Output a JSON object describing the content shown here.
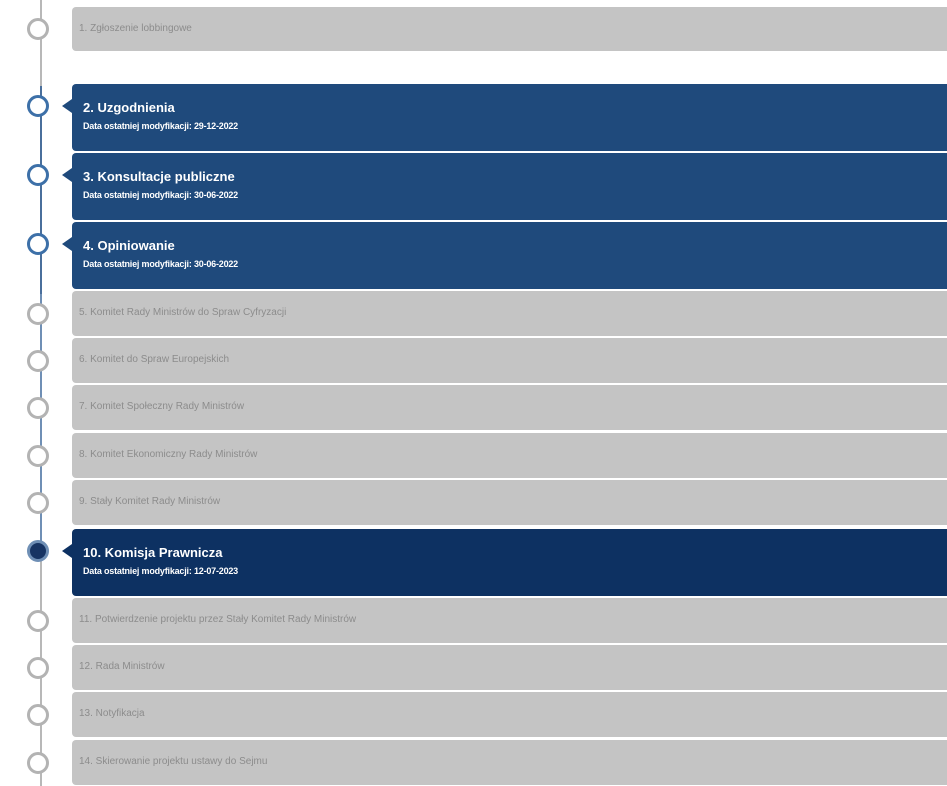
{
  "stages": [
    {
      "label": "1. Zgłoszenie lobbingowe",
      "status": "inactive"
    },
    {
      "label": "2. Uzgodnienia",
      "status": "done",
      "date_prefix": "Data ostatniej modyfikacji:",
      "date": "29-12-2022"
    },
    {
      "label": "3. Konsultacje publiczne",
      "status": "done",
      "date_prefix": "Data ostatniej modyfikacji:",
      "date": "30-06-2022"
    },
    {
      "label": "4. Opiniowanie",
      "status": "done",
      "date_prefix": "Data ostatniej modyfikacji:",
      "date": "30-06-2022"
    },
    {
      "label": "5. Komitet Rady Ministrów do Spraw Cyfryzacji",
      "status": "inactive"
    },
    {
      "label": "6. Komitet do Spraw Europejskich",
      "status": "inactive"
    },
    {
      "label": "7. Komitet Społeczny Rady Ministrów",
      "status": "inactive"
    },
    {
      "label": "8. Komitet Ekonomiczny Rady Ministrów",
      "status": "inactive"
    },
    {
      "label": "9. Stały Komitet Rady Ministrów",
      "status": "inactive"
    },
    {
      "label": "10. Komisja Prawnicza",
      "status": "current",
      "date_prefix": "Data ostatniej modyfikacji:",
      "date": "12-07-2023"
    },
    {
      "label": "11. Potwierdzenie projektu przez Stały Komitet Rady Ministrów",
      "status": "inactive"
    },
    {
      "label": "12. Rada Ministrów",
      "status": "inactive"
    },
    {
      "label": "13. Notyfikacja",
      "status": "inactive"
    },
    {
      "label": "14. Skierowanie projektu ustawy do Sejmu",
      "status": "inactive"
    }
  ],
  "colors": {
    "inactive_bg": "#c4c4c4",
    "done_bg": "#1f4a7c",
    "current_bg": "#0d3162",
    "inactive_node": "#b3b3b3",
    "done_node": "#3d70a8"
  }
}
